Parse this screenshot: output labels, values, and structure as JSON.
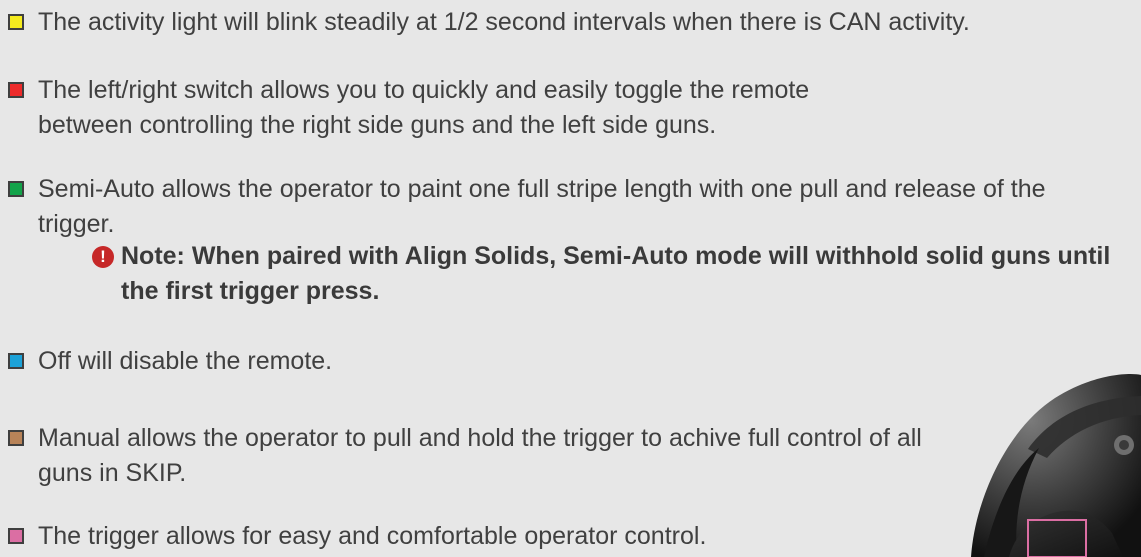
{
  "items": [
    {
      "color": "#f5eb1e",
      "text": "The activity light will blink steadily at 1/2 second intervals when there is CAN activity."
    },
    {
      "color": "#ee2b2b",
      "text": "The left/right switch allows you to quickly and easily toggle the remote between controlling the right side guns and the left side guns."
    },
    {
      "color": "#13a34a",
      "text": "Semi-Auto allows the operator to paint one full stripe length with one pull and release of the trigger."
    },
    {
      "color": "#1ca2d8",
      "text": "Off will disable the remote."
    },
    {
      "color": "#b88358",
      "text": "Manual allows the operator to pull and hold the trigger to achive full control of all guns in SKIP."
    },
    {
      "color": "#db6ea3",
      "text": "The trigger allows for easy and comfortable operator control."
    }
  ],
  "note": {
    "icon": "!",
    "text": "Note: When paired with Align Solids,  Semi-Auto mode will withhold solid guns until the first trigger press."
  }
}
